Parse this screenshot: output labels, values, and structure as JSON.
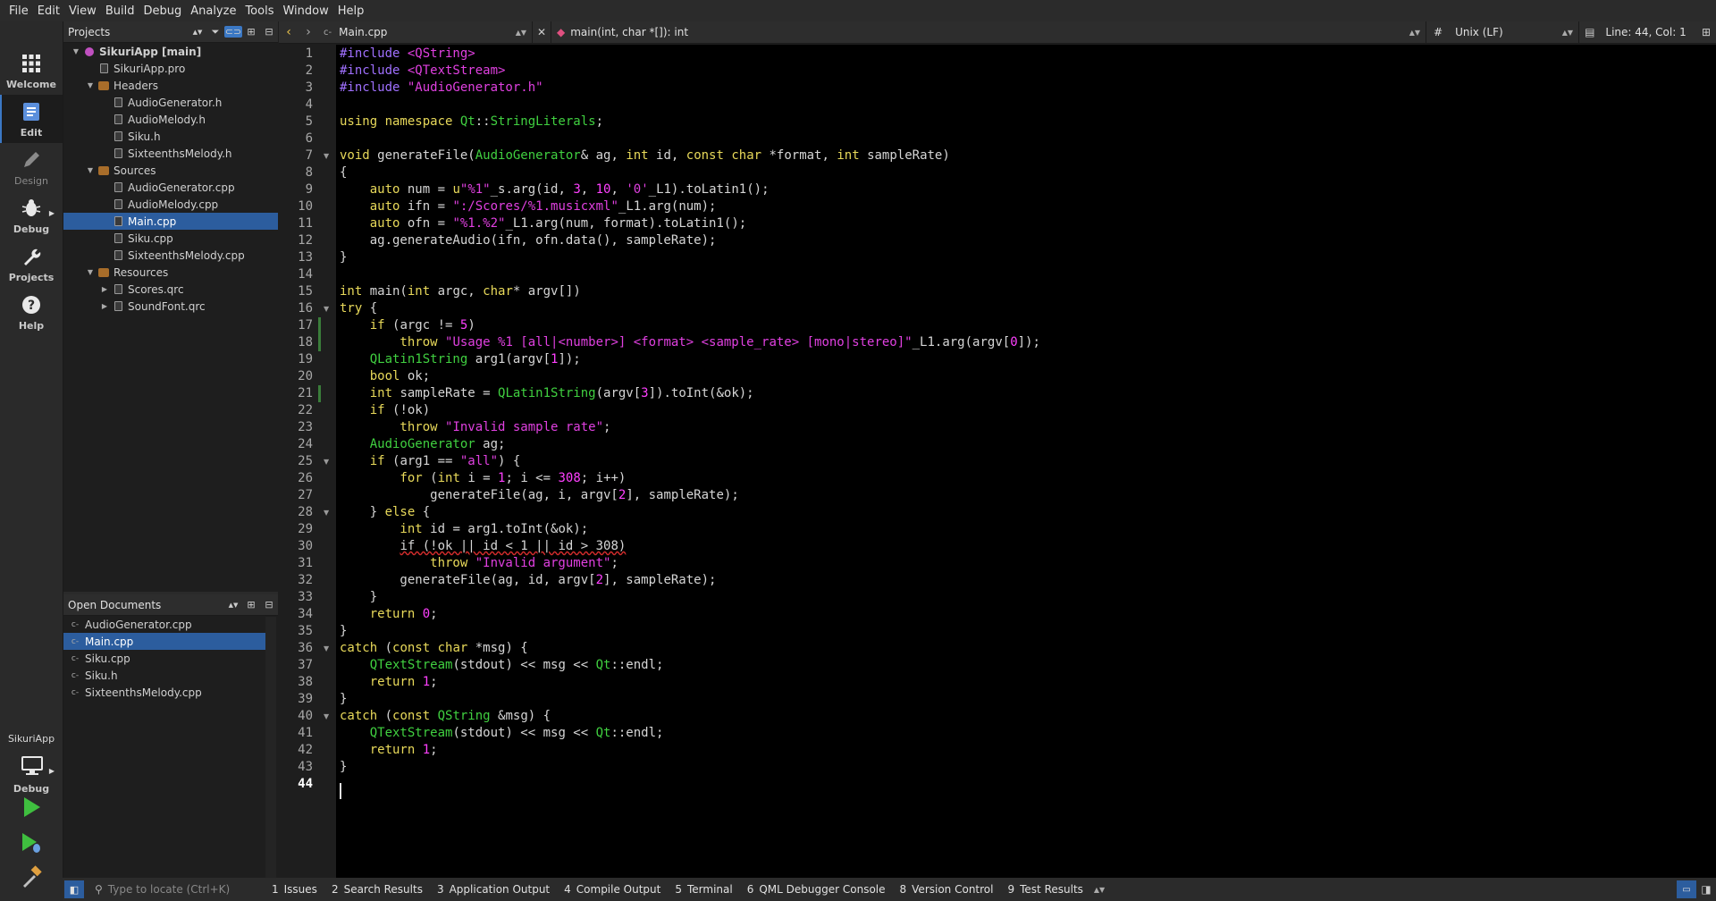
{
  "menu": [
    "File",
    "Edit",
    "View",
    "Build",
    "Debug",
    "Analyze",
    "Tools",
    "Window",
    "Help"
  ],
  "modes": [
    {
      "label": "Welcome",
      "icon": "grid-icon"
    },
    {
      "label": "Edit",
      "icon": "edit-document-icon"
    },
    {
      "label": "Design",
      "icon": "pen-icon"
    },
    {
      "label": "Debug",
      "icon": "bug-icon"
    },
    {
      "label": "Projects",
      "icon": "wrench-icon"
    },
    {
      "label": "Help",
      "icon": "help-icon"
    }
  ],
  "kit": {
    "project": "SikuriApp",
    "config": "Debug"
  },
  "projects_panel": {
    "title": "Projects"
  },
  "tree": [
    {
      "label": "SikuriApp [main]",
      "level": 0,
      "icon": "project",
      "expanded": true,
      "bold": true
    },
    {
      "label": "SikuriApp.pro",
      "level": 1,
      "icon": "file"
    },
    {
      "label": "Headers",
      "level": 1,
      "icon": "folder",
      "expanded": true
    },
    {
      "label": "AudioGenerator.h",
      "level": 2,
      "icon": "file"
    },
    {
      "label": "AudioMelody.h",
      "level": 2,
      "icon": "file"
    },
    {
      "label": "Siku.h",
      "level": 2,
      "icon": "file"
    },
    {
      "label": "SixteenthsMelody.h",
      "level": 2,
      "icon": "file"
    },
    {
      "label": "Sources",
      "level": 1,
      "icon": "folder",
      "expanded": true
    },
    {
      "label": "AudioGenerator.cpp",
      "level": 2,
      "icon": "file"
    },
    {
      "label": "AudioMelody.cpp",
      "level": 2,
      "icon": "file"
    },
    {
      "label": "Main.cpp",
      "level": 2,
      "icon": "file",
      "selected": true
    },
    {
      "label": "Siku.cpp",
      "level": 2,
      "icon": "file"
    },
    {
      "label": "SixteenthsMelody.cpp",
      "level": 2,
      "icon": "file"
    },
    {
      "label": "Resources",
      "level": 1,
      "icon": "folder",
      "expanded": true
    },
    {
      "label": "Scores.qrc",
      "level": 2,
      "icon": "file",
      "collapsed": true
    },
    {
      "label": "SoundFont.qrc",
      "level": 2,
      "icon": "file",
      "collapsed": true
    }
  ],
  "open_docs": {
    "title": "Open Documents",
    "items": [
      "AudioGenerator.cpp",
      "Main.cpp",
      "Siku.cpp",
      "Siku.h",
      "SixteenthsMelody.cpp"
    ],
    "selected": "Main.cpp"
  },
  "editor": {
    "file": "Main.cpp",
    "symbol": "main(int, char *[]): int",
    "line_endings": "Unix (LF)",
    "position": "Line: 44, Col: 1",
    "hash": "#"
  },
  "code_lines": [
    [
      [
        "pp",
        "#include "
      ],
      [
        "inc",
        "<QString>"
      ]
    ],
    [
      [
        "pp",
        "#include "
      ],
      [
        "inc",
        "<QTextStream>"
      ]
    ],
    [
      [
        "pp",
        "#include "
      ],
      [
        "inc",
        "\"AudioGenerator.h\""
      ]
    ],
    [],
    [
      [
        "kw",
        "using namespace "
      ],
      [
        "ty",
        "Qt"
      ],
      [
        "",
        "::"
      ],
      [
        "ty",
        "StringLiterals"
      ],
      [
        "",
        ";"
      ]
    ],
    [],
    [
      [
        "kw",
        "void "
      ],
      [
        "",
        "generateFile("
      ],
      [
        "ty",
        "AudioGenerator"
      ],
      [
        "",
        "& ag, "
      ],
      [
        "kw",
        "int "
      ],
      [
        "",
        "id, "
      ],
      [
        "kw",
        "const char "
      ],
      [
        "",
        "*format, "
      ],
      [
        "kw",
        "int "
      ],
      [
        "",
        "sampleRate)"
      ]
    ],
    [
      [
        "",
        "{"
      ]
    ],
    [
      [
        "ind",
        "  "
      ],
      [
        "kw",
        "  auto "
      ],
      [
        "",
        "num = "
      ],
      [
        "kw",
        "u"
      ],
      [
        "str",
        "\"%1\""
      ],
      [
        "",
        "_s.arg(id, "
      ],
      [
        "num",
        "3"
      ],
      [
        "",
        ", "
      ],
      [
        "num",
        "10"
      ],
      [
        "",
        ", "
      ],
      [
        "str",
        "'0'"
      ],
      [
        "",
        "_L1).toLatin1();"
      ]
    ],
    [
      [
        "ind",
        "  "
      ],
      [
        "kw",
        "  auto "
      ],
      [
        "",
        "ifn = "
      ],
      [
        "str",
        "\":/Scores/%1.musicxml\""
      ],
      [
        "",
        "_L1.arg(num);"
      ]
    ],
    [
      [
        "ind",
        "  "
      ],
      [
        "kw",
        "  auto "
      ],
      [
        "",
        "ofn = "
      ],
      [
        "str",
        "\"%1.%2\""
      ],
      [
        "",
        "_L1.arg(num, format).toLatin1();"
      ]
    ],
    [
      [
        "",
        "    ag.generateAudio(ifn, ofn.data(), sampleRate);"
      ]
    ],
    [
      [
        "",
        "}"
      ]
    ],
    [],
    [
      [
        "kw",
        "int "
      ],
      [
        "",
        "main("
      ],
      [
        "kw",
        "int "
      ],
      [
        "",
        "argc, "
      ],
      [
        "kw",
        "char"
      ],
      [
        "",
        "* argv[])"
      ]
    ],
    [
      [
        "kw",
        "try "
      ],
      [
        "",
        "{"
      ]
    ],
    [
      [
        "kw",
        "    if "
      ],
      [
        "",
        "(argc != "
      ],
      [
        "num",
        "5"
      ],
      [
        "",
        ")"
      ]
    ],
    [
      [
        "kw",
        "        throw "
      ],
      [
        "str",
        "\"Usage %1 [all|<number>] <format> <sample_rate> [mono|stereo]\""
      ],
      [
        "",
        "_L1.arg(argv["
      ],
      [
        "num",
        "0"
      ],
      [
        "",
        "]);"
      ]
    ],
    [
      [
        "ty",
        "    QLatin1String "
      ],
      [
        "",
        "arg1(argv["
      ],
      [
        "num",
        "1"
      ],
      [
        "",
        "]);"
      ]
    ],
    [
      [
        "kw",
        "    bool "
      ],
      [
        "",
        "ok;"
      ]
    ],
    [
      [
        "kw",
        "    int "
      ],
      [
        "",
        "sampleRate = "
      ],
      [
        "ty",
        "QLatin1String"
      ],
      [
        "",
        "(argv["
      ],
      [
        "num",
        "3"
      ],
      [
        "",
        "]).toInt(&ok);"
      ]
    ],
    [
      [
        "kw",
        "    if "
      ],
      [
        "",
        "(!ok)"
      ]
    ],
    [
      [
        "kw",
        "        throw "
      ],
      [
        "str",
        "\"Invalid sample rate\""
      ],
      [
        "",
        ";"
      ]
    ],
    [
      [
        "ty",
        "    AudioGenerator "
      ],
      [
        "",
        "ag;"
      ]
    ],
    [
      [
        "kw",
        "    if "
      ],
      [
        "",
        "(arg1 == "
      ],
      [
        "str",
        "\"all\""
      ],
      [
        "",
        ") {"
      ]
    ],
    [
      [
        "kw",
        "        for "
      ],
      [
        "",
        "("
      ],
      [
        "kw",
        "int "
      ],
      [
        "",
        "i = "
      ],
      [
        "num",
        "1"
      ],
      [
        "",
        "; i <= "
      ],
      [
        "num",
        "308"
      ],
      [
        "",
        "; i++)"
      ]
    ],
    [
      [
        "",
        "            generateFile(ag, i, argv["
      ],
      [
        "num",
        "2"
      ],
      [
        "",
        "], sampleRate);"
      ]
    ],
    [
      [
        "",
        "    } "
      ],
      [
        "kw",
        "else "
      ],
      [
        "",
        "{"
      ]
    ],
    [
      [
        "kw",
        "        int "
      ],
      [
        "",
        "id = arg1.toInt(&ok);"
      ]
    ],
    [
      [
        "",
        "        "
      ],
      [
        "sq",
        "if (!ok || id < 1 || id > 308)"
      ]
    ],
    [
      [
        "kw",
        "            throw "
      ],
      [
        "str",
        "\"Invalid argument\""
      ],
      [
        "",
        ";"
      ]
    ],
    [
      [
        "",
        "        generateFile(ag, id, argv["
      ],
      [
        "num",
        "2"
      ],
      [
        "",
        "], sampleRate);"
      ]
    ],
    [
      [
        "",
        "    }"
      ]
    ],
    [
      [
        "kw",
        "    return "
      ],
      [
        "num",
        "0"
      ],
      [
        "",
        ";"
      ]
    ],
    [
      [
        "",
        "}"
      ]
    ],
    [
      [
        "kw",
        "catch "
      ],
      [
        "",
        "("
      ],
      [
        "kw",
        "const char "
      ],
      [
        "",
        "*msg) {"
      ]
    ],
    [
      [
        "ty",
        "    QTextStream"
      ],
      [
        "",
        "(stdout) << msg << "
      ],
      [
        "ty",
        "Qt"
      ],
      [
        "",
        "::endl;"
      ]
    ],
    [
      [
        "kw",
        "    return "
      ],
      [
        "num",
        "1"
      ],
      [
        "",
        ";"
      ]
    ],
    [
      [
        "",
        "}"
      ]
    ],
    [
      [
        "kw",
        "catch "
      ],
      [
        "",
        "("
      ],
      [
        "kw",
        "const "
      ],
      [
        "ty",
        "QString "
      ],
      [
        "",
        "&msg) {"
      ]
    ],
    [
      [
        "ty",
        "    QTextStream"
      ],
      [
        "",
        "(stdout) << msg << "
      ],
      [
        "ty",
        "Qt"
      ],
      [
        "",
        "::endl;"
      ]
    ],
    [
      [
        "kw",
        "    return "
      ],
      [
        "num",
        "1"
      ],
      [
        "",
        ";"
      ]
    ],
    [
      [
        "",
        "}"
      ]
    ],
    []
  ],
  "fold_lines": [
    7,
    16,
    25,
    28,
    36,
    40
  ],
  "changed_lines": [
    17,
    18,
    21
  ],
  "status": {
    "locate_placeholder": "Type to locate (Ctrl+K)",
    "tabs": [
      {
        "n": "1",
        "label": "Issues"
      },
      {
        "n": "2",
        "label": "Search Results"
      },
      {
        "n": "3",
        "label": "Application Output"
      },
      {
        "n": "4",
        "label": "Compile Output"
      },
      {
        "n": "5",
        "label": "Terminal"
      },
      {
        "n": "6",
        "label": "QML Debugger Console"
      },
      {
        "n": "8",
        "label": "Version Control"
      },
      {
        "n": "9",
        "label": "Test Results"
      }
    ]
  },
  "colors": {
    "accent": "#2c5d9e",
    "keyword": "#e8d95a",
    "string": "#e040e0",
    "type": "#40d040",
    "preproc": "#a070ff"
  }
}
